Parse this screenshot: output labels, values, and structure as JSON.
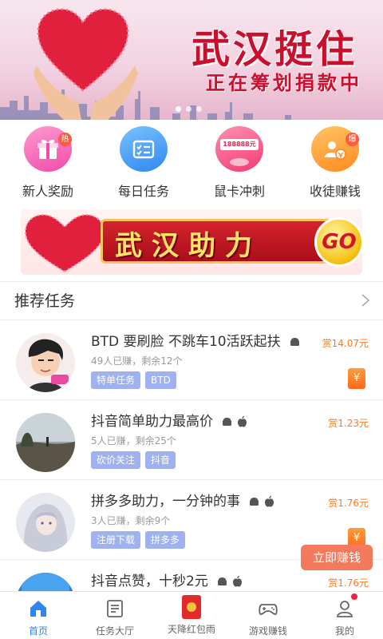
{
  "banner": {
    "title": "武汉挺住",
    "subtitle": "正在筹划捐款中"
  },
  "quick_menu": [
    {
      "label": "新人奖励",
      "badge": "热"
    },
    {
      "label": "每日任务"
    },
    {
      "label": "鼠卡冲刺",
      "card_text": "188888元"
    },
    {
      "label": "收徒赚钱",
      "badge": "爆"
    }
  ],
  "mid_banner": {
    "title": "武汉助力",
    "go": "GO"
  },
  "section": {
    "title": "推荐任务"
  },
  "tasks": [
    {
      "title": "BTD 要刷脸 不跳车10活跃起扶",
      "meta": "49人已赚，剩余12个",
      "reward": "赏14.07元",
      "tags": [
        "特单任务",
        "BTD"
      ],
      "os": [
        "android"
      ],
      "coupon": "¥"
    },
    {
      "title": "抖音简单助力最高价",
      "meta": "5人已赚，剩余25个",
      "reward": "赏1.23元",
      "tags": [
        "砍价关注",
        "抖音"
      ],
      "os": [
        "android",
        "apple"
      ]
    },
    {
      "title": "拼多多助力，一分钟的事",
      "meta": "3人已赚，剩余9个",
      "reward": "赏1.76元",
      "tags": [
        "注册下载",
        "拼多多"
      ],
      "os": [
        "android",
        "apple"
      ],
      "coupon": "¥"
    },
    {
      "title": "抖音点赞，十秒2元",
      "reward": "赏1.76元",
      "os": [
        "android",
        "apple"
      ]
    }
  ],
  "fab": {
    "label": "立即赚钱"
  },
  "nav": [
    {
      "label": "首页",
      "active": true
    },
    {
      "label": "任务大厅"
    },
    {
      "label": "天降红包雨"
    },
    {
      "label": "游戏赚钱"
    },
    {
      "label": "我的"
    }
  ],
  "colors": {
    "accent": "#2f86f0",
    "reward": "#ff7a1e",
    "tag": "#9fb1ee",
    "fab": "#f47a5e"
  }
}
